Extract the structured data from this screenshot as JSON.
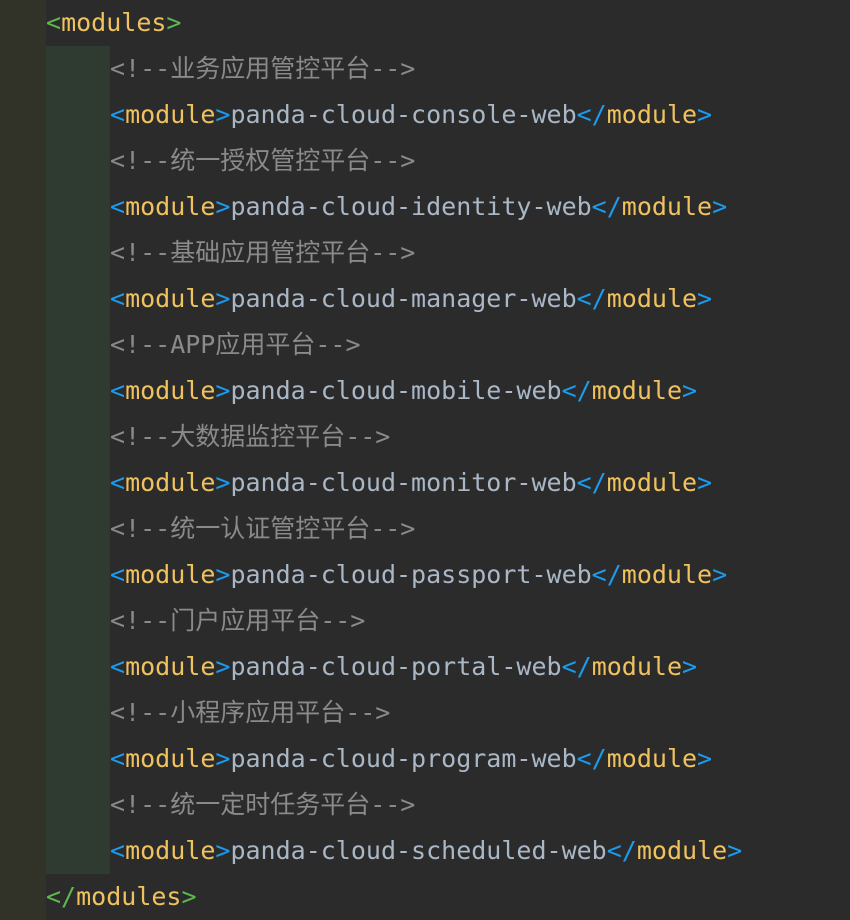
{
  "editor": {
    "root_tag": "modules",
    "child_tag": "module",
    "entries": [
      {
        "comment": "<!--业务应用管控平台-->",
        "value": "panda-cloud-console-web"
      },
      {
        "comment": "<!--统一授权管控平台-->",
        "value": "panda-cloud-identity-web"
      },
      {
        "comment": "<!--基础应用管控平台-->",
        "value": "panda-cloud-manager-web"
      },
      {
        "comment": "<!--APP应用平台-->",
        "value": "panda-cloud-mobile-web"
      },
      {
        "comment": "<!--大数据监控平台-->",
        "value": "panda-cloud-monitor-web"
      },
      {
        "comment": "<!--统一认证管控平台-->",
        "value": "panda-cloud-passport-web"
      },
      {
        "comment": "<!--门户应用平台-->",
        "value": "panda-cloud-portal-web"
      },
      {
        "comment": "<!--小程序应用平台-->",
        "value": "panda-cloud-program-web"
      },
      {
        "comment": "<!--统一定时任务平台-->",
        "value": "panda-cloud-scheduled-web"
      }
    ]
  },
  "colors": {
    "background": "#2b2b2b",
    "gutter": "#313228",
    "indent_guide": "#2f3a30",
    "root_bracket": "#5eb84f",
    "tag_name": "#f0c25e",
    "child_bracket": "#1a9cf0",
    "text": "#a9b7c6",
    "comment": "#8a8a8a"
  }
}
